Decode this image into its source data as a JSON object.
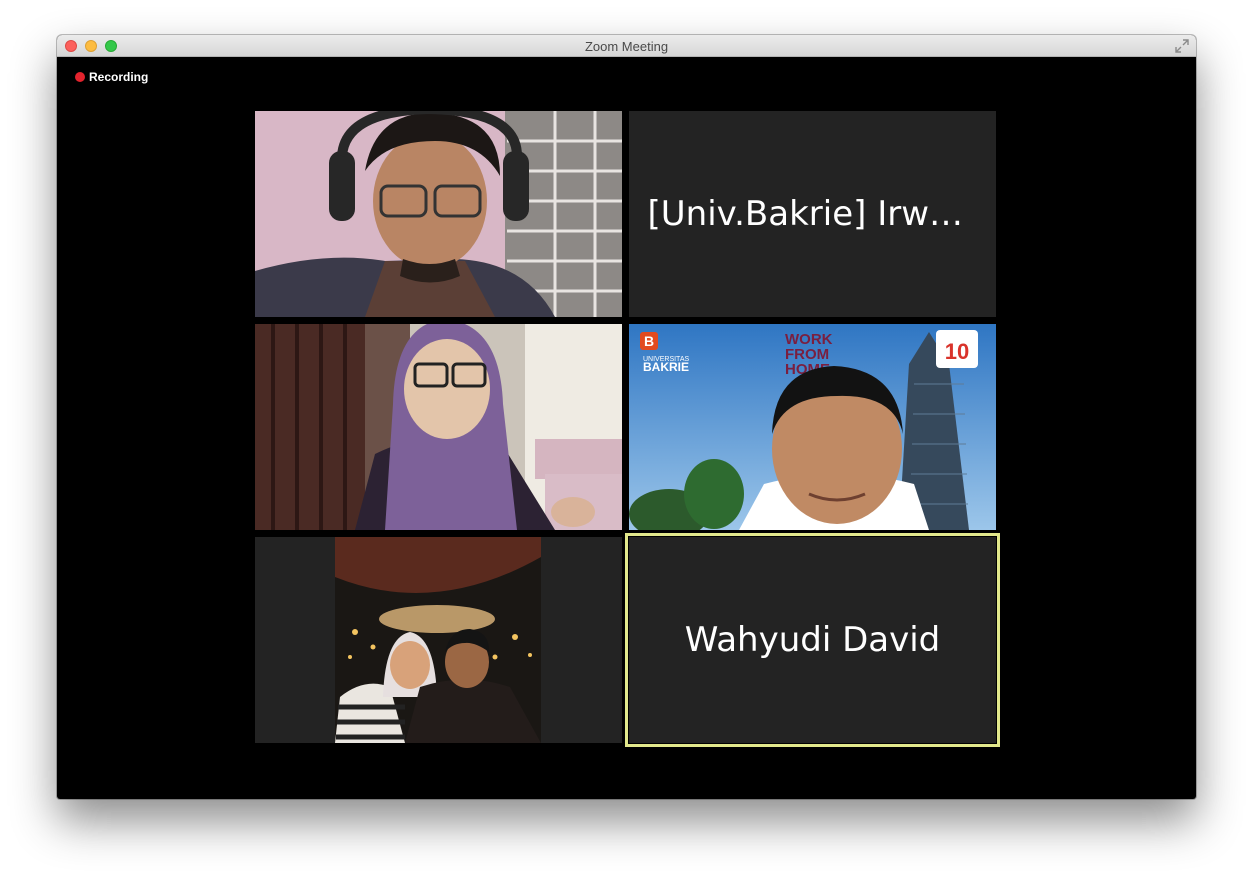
{
  "window": {
    "title": "Zoom Meeting"
  },
  "recording": {
    "label": "Recording"
  },
  "participants": [
    {
      "kind": "video"
    },
    {
      "kind": "name",
      "name": "[Univ.Bakrie] Irwa…"
    },
    {
      "kind": "video"
    },
    {
      "kind": "video",
      "background_text": {
        "university_line1": "UNIVERSITAS",
        "university_line2": "BAKRIE",
        "logo_letter": "B",
        "wfh_line1": "WORK",
        "wfh_line2": "FROM",
        "wfh_line3": "HOME",
        "anniversary": "10"
      }
    },
    {
      "kind": "video"
    },
    {
      "kind": "name",
      "name": "Wahyudi David",
      "active_speaker": true
    }
  ],
  "icons": {
    "fullscreen": "fullscreen-icon",
    "recording": "recording-dot"
  },
  "colors": {
    "recording_dot": "#e3232d",
    "active_speaker_border": "#e2e88c",
    "tile_background": "#232323"
  }
}
